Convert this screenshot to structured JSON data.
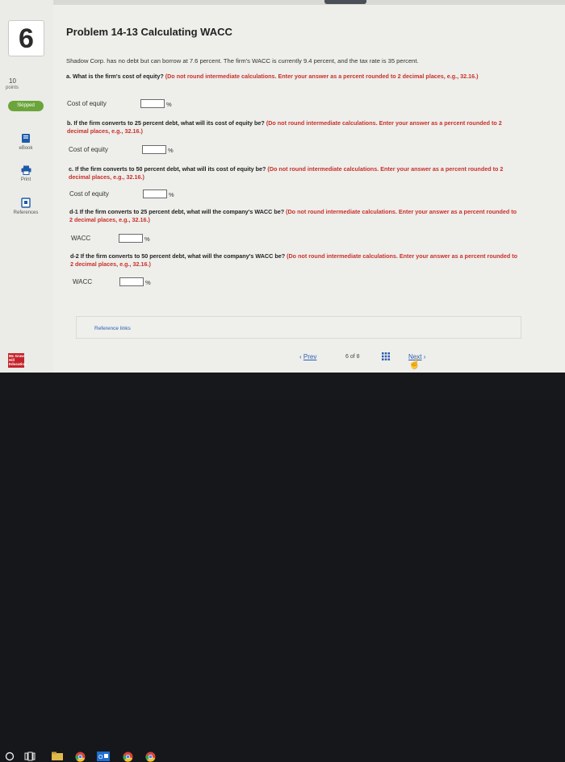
{
  "sidebar": {
    "question_number": "6",
    "points_value": "10",
    "points_label": "points",
    "status_badge": "Skipped",
    "tools": [
      {
        "label": "eBook",
        "icon": "ebook-icon"
      },
      {
        "label": "Print",
        "icon": "printer-icon"
      },
      {
        "label": "References",
        "icon": "references-icon"
      }
    ]
  },
  "problem": {
    "title": "Problem 14-13 Calculating WACC",
    "intro": "Shadow Corp. has no debt but can borrow at 7.6 percent. The firm's WACC is currently 9.4 percent, and the tax rate is 35 percent."
  },
  "questions": {
    "a": {
      "text": "a. What is the firm's cost of equity?",
      "note": "(Do not round intermediate calculations. Enter your answer as a percent rounded to 2 decimal places, e.g., 32.16.)",
      "field_label": "Cost of equity",
      "value": "",
      "unit": "%"
    },
    "b": {
      "text": "b. If the firm converts to 25 percent debt, what will its cost of equity be?",
      "note": "(Do not round intermediate calculations. Enter your answer as a percent rounded to 2 decimal places, e.g., 32.16.)",
      "field_label": "Cost of equity",
      "value": "",
      "unit": "%"
    },
    "c": {
      "text": "c. If the firm converts to 50 percent debt, what will its cost of equity be?",
      "note": "(Do not round intermediate calculations. Enter your answer as a percent rounded to 2 decimal places, e.g., 32.16.)",
      "field_label": "Cost of equity",
      "value": "",
      "unit": "%"
    },
    "d1": {
      "text": "d-1 If the firm converts to 25 percent debt, what will the company's WACC be?",
      "note": "(Do not round intermediate calculations. Enter your answer as a percent rounded to 2 decimal places, e.g., 32.16.)",
      "field_label": "WACC",
      "value": "",
      "unit": "%"
    },
    "d2": {
      "text": "d-2 If the firm converts to 50 percent debt, what will the company's WACC be?",
      "note": "(Do not round intermediate calculations. Enter your answer as a percent rounded to 2 decimal places, e.g., 32.16.)",
      "field_label": "WACC",
      "value": "",
      "unit": "%"
    }
  },
  "reference_links": "Reference links",
  "footer": {
    "publisher_logo": "Mc Graw Hill Education",
    "prev_label": "Prev",
    "page_current": "6",
    "page_of": "of",
    "page_total": "8",
    "next_label": "Next"
  },
  "taskbar": {
    "icons": [
      "start-circle-icon",
      "task-view-icon",
      "file-explorer-icon",
      "chrome-icon",
      "outlook-icon",
      "chrome-icon",
      "chrome-icon"
    ]
  },
  "colors": {
    "skipped_green": "#6ba53a",
    "note_red": "#c8312a",
    "link_blue": "#2a5db0",
    "publisher_red": "#c4232b"
  }
}
